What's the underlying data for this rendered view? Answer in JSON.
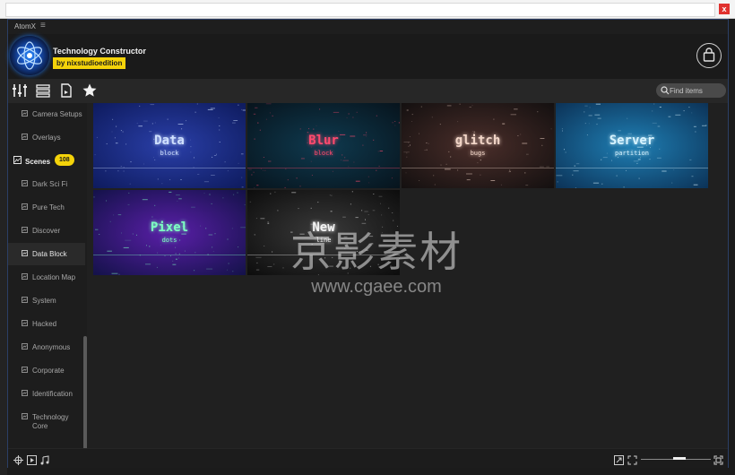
{
  "window": {
    "app_name": "AtomX",
    "menu_glyph": "≡",
    "close_glyph": "x"
  },
  "header": {
    "product_title": "Technology Constructor",
    "product_badge": "by nixstudioedition"
  },
  "toolbar": {
    "tools": [
      "sliders-icon",
      "list-icon",
      "add-file-icon",
      "star-icon"
    ],
    "search_placeholder": "Find items"
  },
  "sidebar": {
    "items_top": [
      {
        "label": "Camera Setups"
      },
      {
        "label": "Overlays"
      }
    ],
    "category": {
      "label": "Scenes",
      "count": "108"
    },
    "items": [
      {
        "label": "Dark Sci Fi"
      },
      {
        "label": "Pure Tech"
      },
      {
        "label": "Discover"
      },
      {
        "label": "Data Block",
        "active": true
      },
      {
        "label": "Location Map"
      },
      {
        "label": "System"
      },
      {
        "label": "Hacked"
      },
      {
        "label": "Anonymous"
      },
      {
        "label": "Corporate"
      },
      {
        "label": "Identification"
      },
      {
        "label": "Technology",
        "label2": "Core"
      }
    ]
  },
  "tiles": [
    {
      "title": "Data",
      "subtitle": "block",
      "bg1": "#2a3fa8",
      "bg2": "#0e1b5e",
      "color": "#cfe0ff"
    },
    {
      "title": "Blur",
      "subtitle": "block",
      "bg1": "#0f3a4f",
      "bg2": "#07141d",
      "color": "#ff4a6e"
    },
    {
      "title": "glitch",
      "subtitle": "bugs",
      "bg1": "#4a2e2a",
      "bg2": "#141010",
      "color": "#f2d6c8"
    },
    {
      "title": "Server",
      "subtitle": "partition",
      "bg1": "#1f7fb4",
      "bg2": "#0c3358",
      "color": "#d8f4ff"
    },
    {
      "title": "Pixel",
      "subtitle": "dots",
      "bg1": "#5a1fa8",
      "bg2": "#14124a",
      "color": "#7dffc2"
    },
    {
      "title": "New",
      "subtitle": "line",
      "bg1": "#3a3a3a",
      "bg2": "#0d0d0d",
      "color": "#f4f4f4"
    }
  ],
  "watermark": {
    "cn": "京影素材",
    "url": "www.cgaee.com"
  },
  "footer": {
    "icons": [
      "target-icon",
      "play-icon",
      "music-icon"
    ],
    "right_icons": [
      "expand-icon",
      "fit-icon",
      "fullscreen-icon"
    ],
    "zoom": 0.5
  }
}
